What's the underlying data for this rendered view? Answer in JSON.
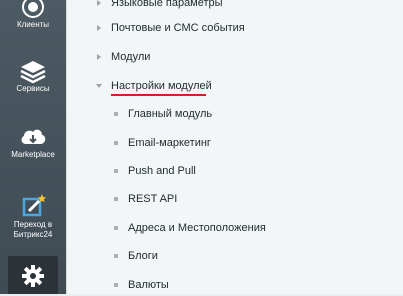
{
  "sidebar": {
    "items": [
      {
        "label": "Клиенты",
        "icon": "clients-icon"
      },
      {
        "label": "Сервисы",
        "icon": "layers-icon"
      },
      {
        "label": "Marketplace",
        "icon": "cloud-download-icon"
      },
      {
        "label_line1": "Переход в",
        "label_line2": "Битрикс24",
        "icon": "edit-star-icon"
      },
      {
        "icon": "gear-icon"
      }
    ]
  },
  "menu": {
    "items": [
      {
        "label": "Языковые параметры",
        "type": "collapsed"
      },
      {
        "label": "Почтовые и СМС события",
        "type": "collapsed"
      },
      {
        "label": "Модули",
        "type": "collapsed"
      },
      {
        "label": "Настройки модулей",
        "type": "expanded",
        "active": true
      }
    ],
    "subitems": [
      {
        "label": "Главный модуль"
      },
      {
        "label": "Email-маркетинг"
      },
      {
        "label": "Push and Pull"
      },
      {
        "label": "REST API"
      },
      {
        "label": "Адреса и Местоположения"
      },
      {
        "label": "Блоги"
      },
      {
        "label": "Валюты"
      }
    ]
  },
  "colors": {
    "sidebar": "#46535b",
    "accent_underline": "#d0202a",
    "panel_bg": "#f3f6f7"
  }
}
